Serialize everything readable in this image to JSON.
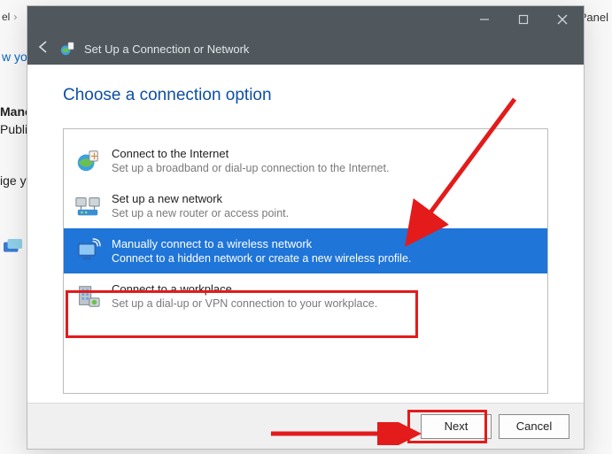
{
  "background": {
    "crumb_left": "el",
    "crumb_arrow": "›",
    "trol": "trol Panel",
    "wyo": "w yo",
    "mano": "Mano",
    "publi": "Publi",
    "igey": "ige y"
  },
  "dialog": {
    "title": "Set Up a Connection or Network",
    "heading": "Choose a connection option",
    "options": [
      {
        "title": "Connect to the Internet",
        "desc": "Set up a broadband or dial-up connection to the Internet."
      },
      {
        "title": "Set up a new network",
        "desc": "Set up a new router or access point."
      },
      {
        "title": "Manually connect to a wireless network",
        "desc": "Connect to a hidden network or create a new wireless profile."
      },
      {
        "title": "Connect to a workplace",
        "desc": "Set up a dial-up or VPN connection to your workplace."
      }
    ],
    "buttons": {
      "next": "Next",
      "cancel": "Cancel"
    }
  }
}
